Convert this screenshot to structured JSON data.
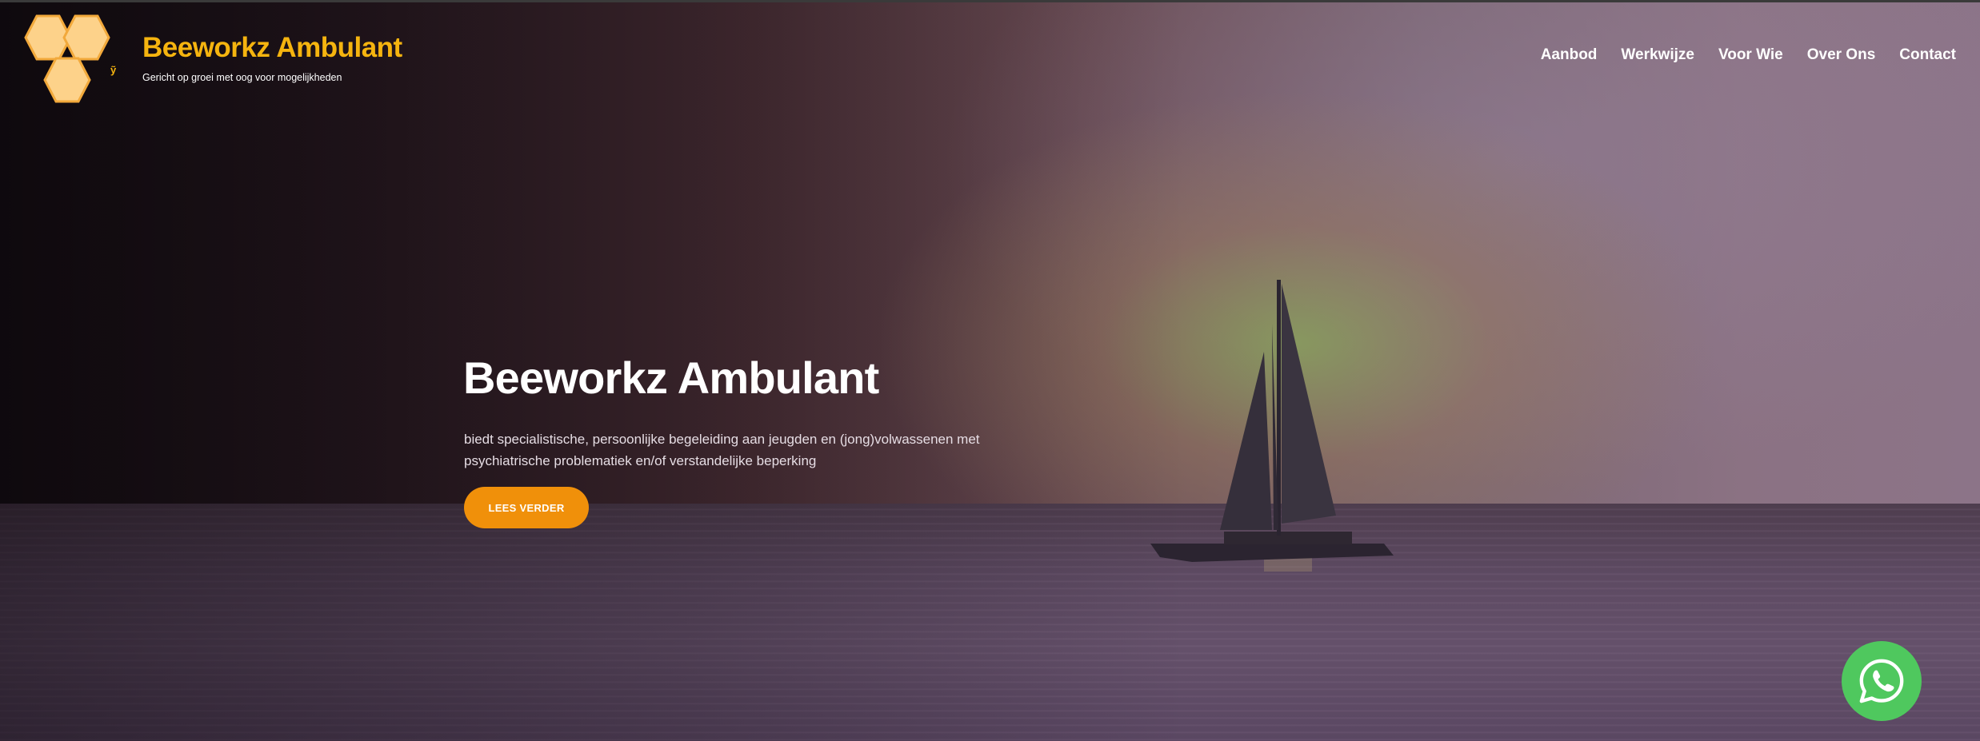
{
  "header": {
    "brand": "Beeworkz Ambulant",
    "tagline": "Gericht op groei met oog voor mogelijkheden",
    "logo_icon": "honeycomb-bee-logo"
  },
  "nav": {
    "items": [
      {
        "label": "Aanbod"
      },
      {
        "label": "Werkwijze"
      },
      {
        "label": "Voor Wie"
      },
      {
        "label": "Over Ons"
      },
      {
        "label": "Contact"
      }
    ]
  },
  "hero": {
    "title": "Beeworkz Ambulant",
    "description": "biedt specialistische, persoonlijke begeleiding aan jeugden en (jong)volwassenen met psychiatrische problematiek en/of verstandelijke beperking",
    "cta_label": "LEES VERDER",
    "background": "sailboat-sunset-sea-photo"
  },
  "floating": {
    "whatsapp_icon": "whatsapp-icon"
  },
  "colors": {
    "brand_accent": "#f5b40f",
    "cta": "#f0900a",
    "whatsapp": "#4fc85e"
  }
}
